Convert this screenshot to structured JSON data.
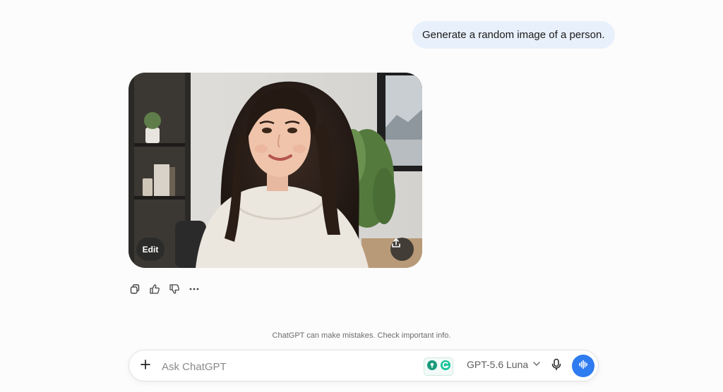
{
  "conversation": {
    "user_message": "Generate a random image of a person."
  },
  "image_card": {
    "edit_label": "Edit",
    "share_icon": "share-icon"
  },
  "message_actions": {
    "icons": [
      "copy-icon",
      "thumbs-up-icon",
      "thumbs-down-icon",
      "more-icon"
    ]
  },
  "footer": {
    "disclaimer": "ChatGPT can make mistakes. Check important info."
  },
  "composer": {
    "placeholder": "Ask ChatGPT",
    "value": "",
    "model_label": "GPT-5.6 Luna",
    "accent_color": "#2f7bf0"
  }
}
